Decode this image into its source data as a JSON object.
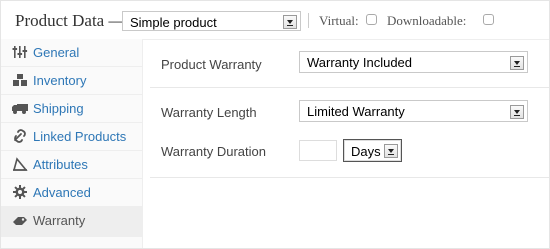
{
  "header": {
    "title": "Product Data —",
    "product_type": "Simple product",
    "virtual_label": "Virtual:",
    "downloadable_label": "Downloadable:"
  },
  "tabs": [
    {
      "label": "General",
      "icon": "sliders-icon"
    },
    {
      "label": "Inventory",
      "icon": "boxes-icon"
    },
    {
      "label": "Shipping",
      "icon": "truck-icon"
    },
    {
      "label": "Linked Products",
      "icon": "link-icon"
    },
    {
      "label": "Attributes",
      "icon": "tag-icon"
    },
    {
      "label": "Advanced",
      "icon": "gear-icon"
    },
    {
      "label": "Warranty",
      "icon": "warranty-icon"
    }
  ],
  "active_tab": "Warranty",
  "fields": {
    "warranty_label": "Product Warranty",
    "warranty_value": "Warranty Included",
    "length_label": "Warranty Length",
    "length_value": "Limited Warranty",
    "duration_label": "Warranty Duration",
    "duration_amount": "",
    "duration_unit": "Days"
  },
  "colors": {
    "link": "#2e77b6",
    "active_tab_bg": "#eeeeee"
  }
}
